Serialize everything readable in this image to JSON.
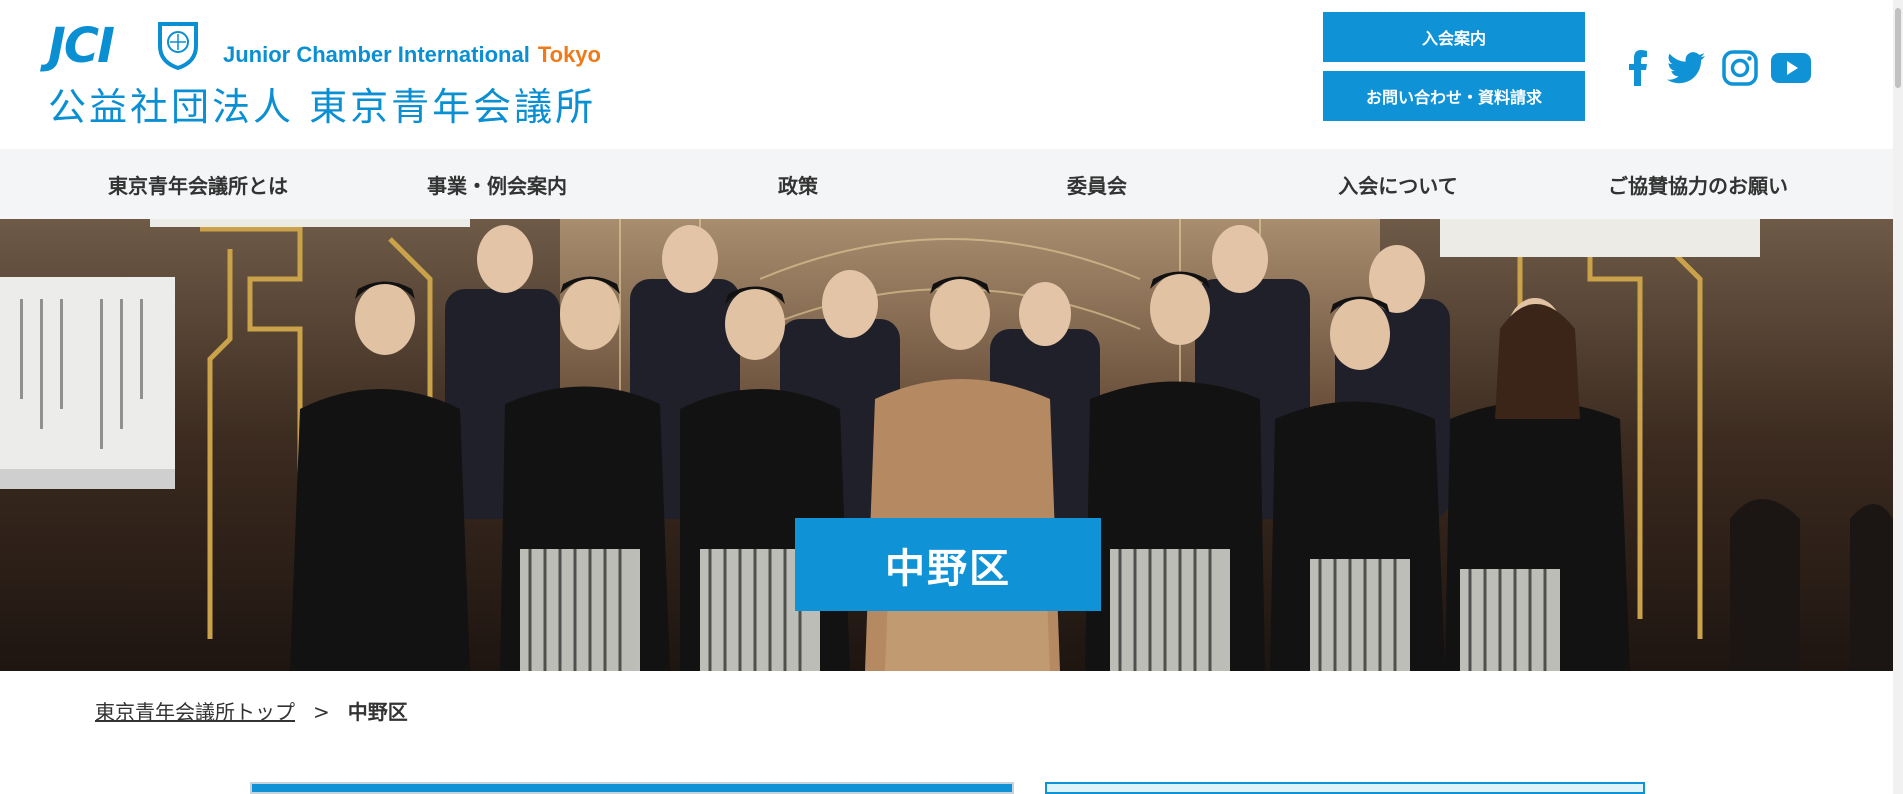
{
  "logo": {
    "mark": "JCI",
    "english": "Junior Chamber International",
    "city": "Tokyo",
    "japanese": "公益社団法人 東京青年会議所"
  },
  "header_buttons": {
    "join": "入会案内",
    "contact": "お問い合わせ・資料請求"
  },
  "social": [
    {
      "icon": "facebook-icon"
    },
    {
      "icon": "twitter-icon"
    },
    {
      "icon": "instagram-icon"
    },
    {
      "icon": "youtube-icon"
    }
  ],
  "nav": [
    "東京青年会議所とは",
    "事業・例会案内",
    "政策",
    "委員会",
    "入会について",
    "ご協賛協力のお願い"
  ],
  "hero": {
    "title": "中野区"
  },
  "breadcrumb": {
    "home": "東京青年会議所トップ",
    "separator": ">",
    "current": "中野区"
  },
  "colors": {
    "brand_blue": "#0f92d6",
    "tokyo_orange": "#ee7b1b",
    "nav_bg": "#f3f5f7"
  }
}
